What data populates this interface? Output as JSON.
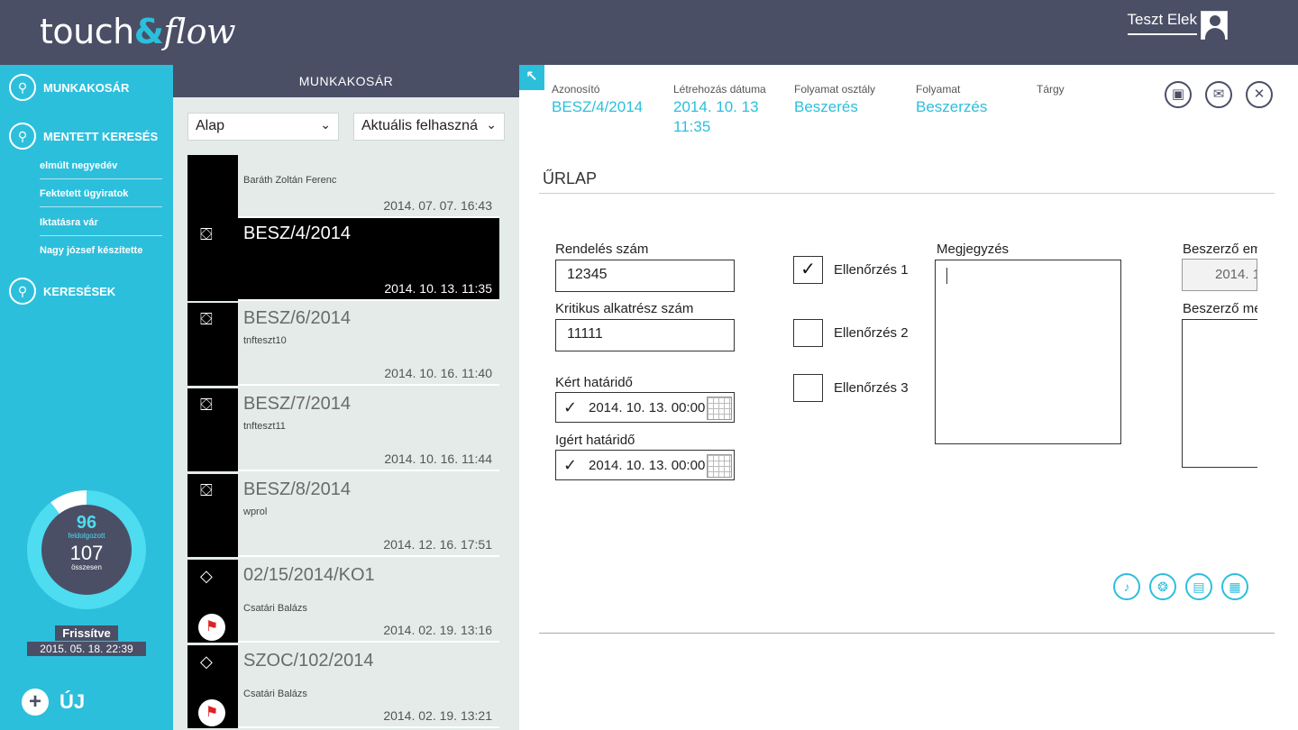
{
  "app": {
    "logo_text_a": "touch",
    "logo_text_amp": "&",
    "logo_text_b": "flow",
    "user_name": "Teszt Elek",
    "accent_color": "#2cbfdc",
    "header_color": "#4a4f66"
  },
  "sidebar": {
    "workbasket": "MUNKAKOSÁR",
    "saved_search": "MENTETT KERESÉS",
    "saved_items": [
      "elmúlt negyedév",
      "Fektetett ügyiratok",
      "Iktatásra vár",
      "Nagy józsef készítette"
    ],
    "searches": "KERESÉSEK",
    "stats": {
      "processed": "96",
      "processed_label": "feldolgozott",
      "total": "107",
      "total_label": "összesen",
      "processed_fraction": 0.897
    },
    "refreshed_label": "Frissítve",
    "refreshed_date": "2015. 05. 18. 22:39",
    "new_label": "ÚJ"
  },
  "list": {
    "header": "MUNKAKOSÁR",
    "filter1": "Alap",
    "filter2": "Aktuális felhaszná",
    "items": [
      {
        "title": "",
        "sub": "Baráth Zoltán Ferenc",
        "date": "2014. 07. 07. 16:43",
        "icon": "process-icon"
      },
      {
        "title": "BESZ/4/2014",
        "sub": "",
        "date": "2014. 10. 13. 11:35",
        "icon": "process-icon"
      },
      {
        "title": "BESZ/6/2014",
        "sub": "tnfteszt10",
        "date": "2014. 10. 16. 11:40",
        "icon": "process-icon"
      },
      {
        "title": "BESZ/7/2014",
        "sub": "tnfteszt11",
        "date": "2014. 10. 16. 11:44",
        "icon": "process-icon"
      },
      {
        "title": "BESZ/8/2014",
        "sub": "wprol",
        "date": "2014. 12. 16. 17:51",
        "icon": "process-icon"
      },
      {
        "title": "02/15/2014/KO1",
        "sub": "Csatári Balázs",
        "date": "2014. 02. 19. 13:16",
        "icon": "document-icon"
      },
      {
        "title": "SZOC/102/2014",
        "sub": "Csatári Balázs",
        "date": "2014. 02. 19. 13:21",
        "icon": "document-icon"
      }
    ]
  },
  "detail": {
    "id_label": "Azonosító",
    "id_value": "BESZ/4/2014",
    "created_label": "Létrehozás dátuma",
    "created_value_1": "2014. 10. 13",
    "created_value_2": "11:35",
    "class_label": "Folyamat osztály",
    "class_value": "Beszerés",
    "process_label": "Folyamat",
    "process_value": "Beszerzés",
    "subject_label": "Tárgy",
    "section_title": "ŰRLAP",
    "order_no_label": "Rendelés szám",
    "order_no_value": "12345",
    "critical_label": "Kritikus alkatrész szám",
    "critical_value": "11111",
    "requested_label": "Kért határidő",
    "requested_value": "2014. 10. 13. 00:00",
    "promised_label": "Igért határidő",
    "promised_value": "2014. 10. 13. 00:00",
    "check1_label": "Ellenőrzés 1",
    "check2_label": "Ellenőrzés 2",
    "check3_label": "Ellenőrzés 3",
    "note_label": "Megjegyzés",
    "buyer_em_label": "Beszerző em",
    "buyer_em_value": "2014. 1",
    "buyer_me_label": "Beszerző me"
  }
}
